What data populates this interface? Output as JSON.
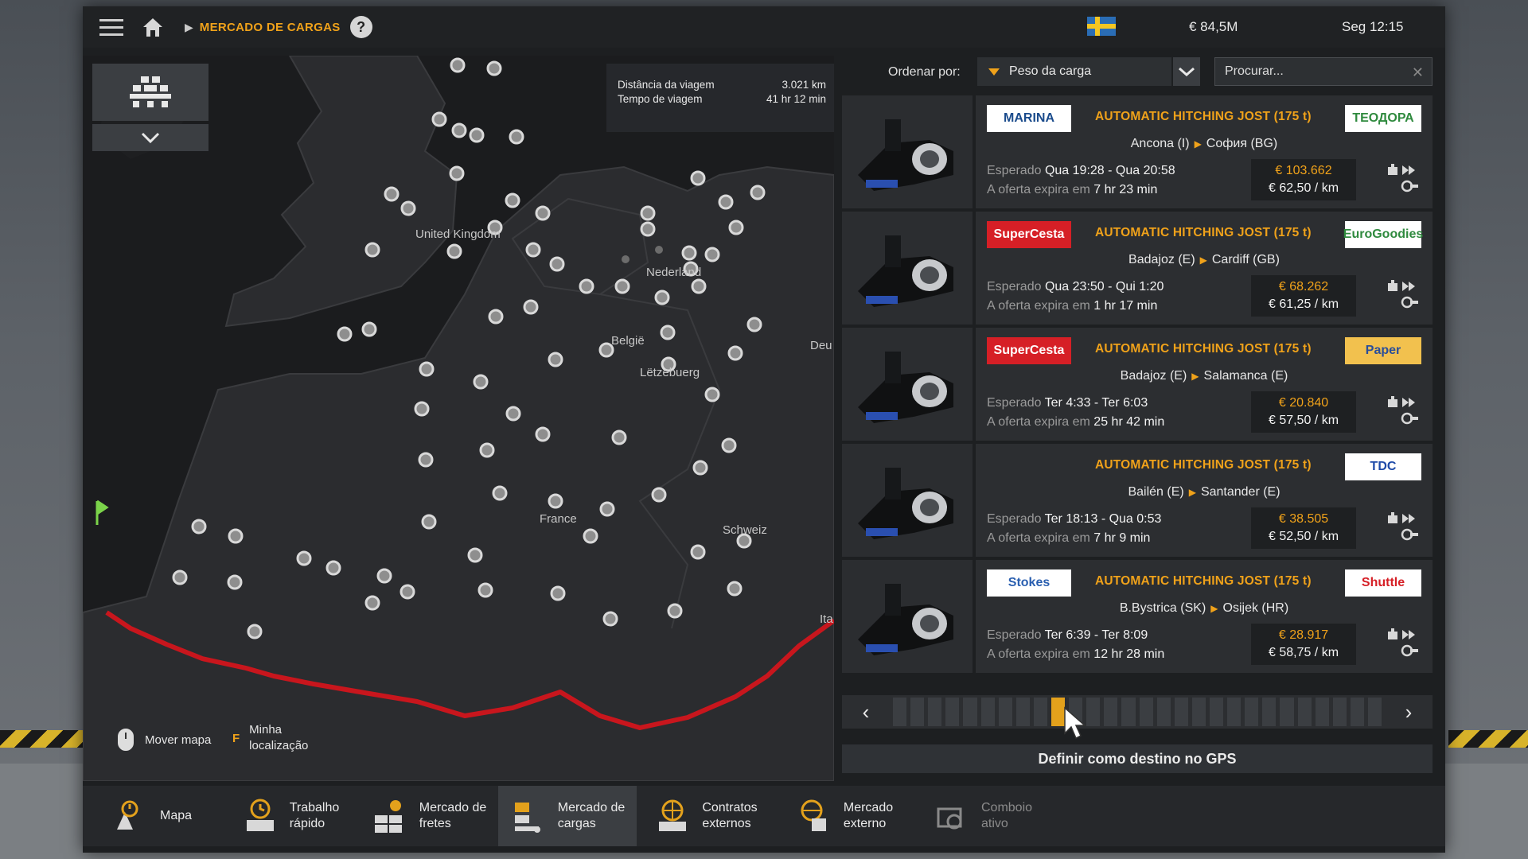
{
  "topbar": {
    "breadcrumb": "MERCADO DE CARGAS",
    "help": "?",
    "money": "€ 84,5M",
    "clock": "Seg 12:15"
  },
  "trip": {
    "distance_label": "Distância da viagem",
    "distance_value": "3.021 km",
    "time_label": "Tempo de viagem",
    "time_value": "41 hr 12 min"
  },
  "map": {
    "labels": [
      "United Kingdom",
      "Nederland",
      "België",
      "Lëtzebuerg",
      "Deu",
      "France",
      "Schweiz",
      "Ita"
    ],
    "hint_move": "Mover mapa",
    "hint_key": "F",
    "hint_location_1": "Minha",
    "hint_location_2": "localização"
  },
  "sort": {
    "label": "Ordenar por:",
    "selected": "Peso da carga",
    "search_placeholder": "Procurar..."
  },
  "jobs": [
    {
      "company": "MARINA",
      "cargo": "AUTOMATIC HITCHING JOST (175 t)",
      "from": "Ancona (I)",
      "to": "София (BG)",
      "expected_label": "Esperado",
      "expected": "Qua 19:28 - Qua 20:58",
      "expires_label": "A oferta expira em",
      "expires": "7 hr 23 min",
      "price": "€ 103.662",
      "per_km": "€ 62,50 / km",
      "client": "ТЕОДОРА"
    },
    {
      "company": "SuperCesta",
      "cargo": "AUTOMATIC HITCHING JOST (175 t)",
      "from": "Badajoz (E)",
      "to": "Cardiff (GB)",
      "expected_label": "Esperado",
      "expected": "Qua 23:50 - Qui 1:20",
      "expires_label": "A oferta expira em",
      "expires": "1 hr 17 min",
      "price": "€ 68.262",
      "per_km": "€ 61,25 / km",
      "client": "EuroGoodies"
    },
    {
      "company": "SuperCesta",
      "cargo": "AUTOMATIC HITCHING JOST (175 t)",
      "from": "Badajoz (E)",
      "to": "Salamanca (E)",
      "expected_label": "Esperado",
      "expected": "Ter 4:33 - Ter 6:03",
      "expires_label": "A oferta expira em",
      "expires": "25 hr 42 min",
      "price": "€ 20.840",
      "per_km": "€ 57,50 / km",
      "client": "Paper"
    },
    {
      "company": "",
      "cargo": "AUTOMATIC HITCHING JOST (175 t)",
      "from": "Bailén (E)",
      "to": "Santander (E)",
      "expected_label": "Esperado",
      "expected": "Ter 18:13 - Qua 0:53",
      "expires_label": "A oferta expira em",
      "expires": "7 hr 9 min",
      "price": "€ 38.505",
      "per_km": "€ 52,50 / km",
      "client": "TDC"
    },
    {
      "company": "Stokes",
      "cargo": "AUTOMATIC HITCHING JOST (175 t)",
      "from": "B.Bystrica (SK)",
      "to": "Osijek (HR)",
      "expected_label": "Esperado",
      "expected": "Ter 6:39 - Ter 8:09",
      "expires_label": "A oferta expira em",
      "expires": "12 hr 28 min",
      "price": "€ 28.917",
      "per_km": "€ 58,75 / km",
      "client": "Shuttle"
    }
  ],
  "pager": {
    "total": 28,
    "active": 9
  },
  "gps_button": "Definir como destino no GPS",
  "nav": [
    {
      "line1": "Mapa",
      "line2": "",
      "icon": "map-icon"
    },
    {
      "line1": "Trabalho",
      "line2": "rápido",
      "icon": "quick-job-icon"
    },
    {
      "line1": "Mercado de",
      "line2": "fretes",
      "icon": "freight-market-icon"
    },
    {
      "line1": "Mercado de",
      "line2": "cargas",
      "icon": "cargo-market-icon"
    },
    {
      "line1": "Contratos",
      "line2": "externos",
      "icon": "external-contracts-icon"
    },
    {
      "line1": "Mercado",
      "line2": "externo",
      "icon": "external-market-icon"
    },
    {
      "line1": "Comboio",
      "line2": "ativo",
      "icon": "convoy-icon"
    }
  ],
  "colors": {
    "accent": "#f0a21a",
    "route": "#c8161d",
    "panel": "#2c2e31"
  }
}
